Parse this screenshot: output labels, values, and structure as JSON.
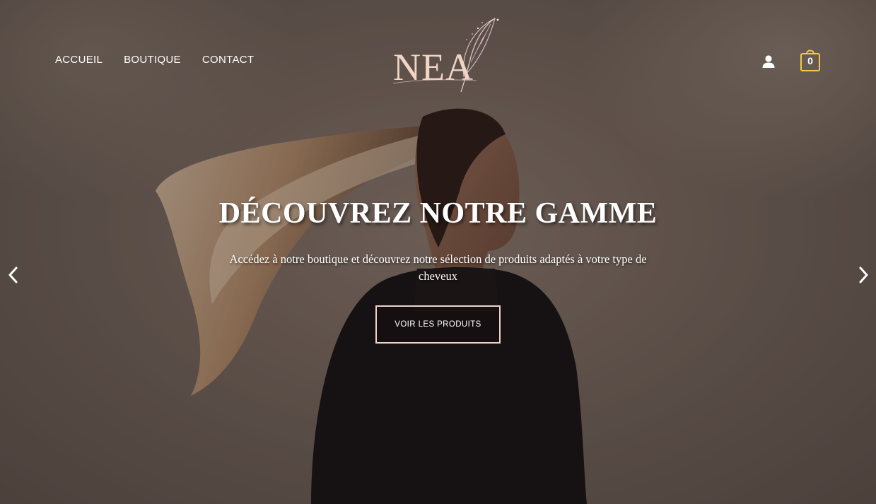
{
  "header": {
    "nav": [
      {
        "label": "ACCUEIL"
      },
      {
        "label": "BOUTIQUE"
      },
      {
        "label": "CONTACT"
      }
    ],
    "logo": {
      "text": "NEA",
      "icon": "feather-icon"
    },
    "account_icon": "user-icon",
    "cart": {
      "icon": "shopping-bag-icon",
      "count": "0"
    }
  },
  "slider": {
    "title": "DÉCOUVREZ NOTRE GAMME",
    "subtitle": "Accédez à notre boutique et découvrez notre sélection de produits adaptés à votre type de cheveux",
    "cta_label": "VOIR LES PRODUITS",
    "prev_icon": "chevron-left-icon",
    "next_icon": "chevron-right-icon"
  },
  "colors": {
    "accent": "#f1d2c3",
    "text": "#ffffff",
    "background": "#7a6a60"
  }
}
